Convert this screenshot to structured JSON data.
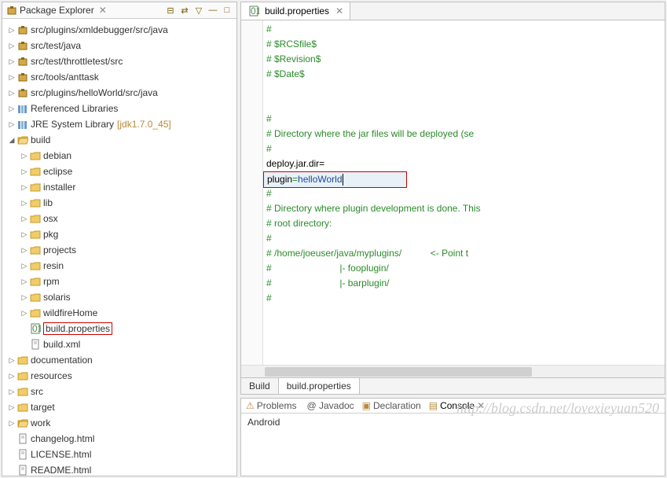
{
  "explorer": {
    "title": "Package Explorer",
    "toolbar": [
      "collapse",
      "link",
      "refresh",
      "menu",
      "min",
      "max"
    ],
    "tree": [
      {
        "ind": 4,
        "arrow": "▷",
        "icon": "pkg",
        "label": "src/plugins/xmldebugger/src/java"
      },
      {
        "ind": 4,
        "arrow": "▷",
        "icon": "pkg",
        "label": "src/test/java"
      },
      {
        "ind": 4,
        "arrow": "▷",
        "icon": "pkg",
        "label": "src/test/throttletest/src"
      },
      {
        "ind": 4,
        "arrow": "▷",
        "icon": "pkg",
        "label": "src/tools/anttask"
      },
      {
        "ind": 4,
        "arrow": "▷",
        "icon": "pkg",
        "label": "src/plugins/helloWorld/src/java"
      },
      {
        "ind": 4,
        "arrow": "▷",
        "icon": "lib",
        "label": "Referenced Libraries"
      },
      {
        "ind": 4,
        "arrow": "▷",
        "icon": "lib",
        "label": "JRE System Library",
        "extra": "[jdk1.7.0_45]"
      },
      {
        "ind": 4,
        "arrow": "◢",
        "icon": "folder-open",
        "label": "build"
      },
      {
        "ind": 20,
        "arrow": "▷",
        "icon": "folder",
        "label": "debian"
      },
      {
        "ind": 20,
        "arrow": "▷",
        "icon": "folder",
        "label": "eclipse"
      },
      {
        "ind": 20,
        "arrow": "▷",
        "icon": "folder",
        "label": "installer"
      },
      {
        "ind": 20,
        "arrow": "▷",
        "icon": "folder",
        "label": "lib"
      },
      {
        "ind": 20,
        "arrow": "▷",
        "icon": "folder",
        "label": "osx"
      },
      {
        "ind": 20,
        "arrow": "▷",
        "icon": "folder",
        "label": "pkg"
      },
      {
        "ind": 20,
        "arrow": "▷",
        "icon": "folder",
        "label": "projects"
      },
      {
        "ind": 20,
        "arrow": "▷",
        "icon": "folder",
        "label": "resin"
      },
      {
        "ind": 20,
        "arrow": "▷",
        "icon": "folder",
        "label": "rpm"
      },
      {
        "ind": 20,
        "arrow": "▷",
        "icon": "folder",
        "label": "solaris"
      },
      {
        "ind": 20,
        "arrow": "▷",
        "icon": "folder",
        "label": "wildfireHome"
      },
      {
        "ind": 20,
        "arrow": "",
        "icon": "props",
        "label": "build.properties",
        "hl": true
      },
      {
        "ind": 20,
        "arrow": "",
        "icon": "file",
        "label": "build.xml"
      },
      {
        "ind": 4,
        "arrow": "▷",
        "icon": "folder",
        "label": "documentation"
      },
      {
        "ind": 4,
        "arrow": "▷",
        "icon": "folder",
        "label": "resources"
      },
      {
        "ind": 4,
        "arrow": "▷",
        "icon": "folder",
        "label": "src"
      },
      {
        "ind": 4,
        "arrow": "▷",
        "icon": "folder",
        "label": "target"
      },
      {
        "ind": 4,
        "arrow": "▷",
        "icon": "folder-open",
        "label": "work"
      },
      {
        "ind": 4,
        "arrow": "",
        "icon": "file",
        "label": "changelog.html"
      },
      {
        "ind": 4,
        "arrow": "",
        "icon": "file",
        "label": "LICENSE.html"
      },
      {
        "ind": 4,
        "arrow": "",
        "icon": "file",
        "label": "README.html"
      }
    ]
  },
  "editor": {
    "tab": {
      "label": "build.properties",
      "icon": "props"
    },
    "lines": [
      {
        "t": "#",
        "c": "c"
      },
      {
        "t": "# $RCSfile$",
        "c": "c"
      },
      {
        "t": "# $Revision$",
        "c": "c"
      },
      {
        "t": "# $Date$",
        "c": "c"
      },
      {
        "t": "",
        "c": "c"
      },
      {
        "t": "",
        "c": "c"
      },
      {
        "t": "#",
        "c": "c"
      },
      {
        "t": "# Directory where the jar files will be deployed (se",
        "c": "c"
      },
      {
        "t": "#",
        "c": "c"
      },
      {
        "t": "deploy.jar.dir=",
        "c": "k"
      },
      {
        "t": "",
        "c": "hl",
        "key": "plugin",
        "val": "helloWorld"
      },
      {
        "t": "#",
        "c": "c"
      },
      {
        "t": "# Directory where plugin development is done. This ",
        "c": "c"
      },
      {
        "t": "# root directory:",
        "c": "c"
      },
      {
        "t": "#",
        "c": "c"
      },
      {
        "t": "# /home/joeuser/java/myplugins/           <- Point t",
        "c": "c"
      },
      {
        "t": "#                          |- fooplugin/",
        "c": "c"
      },
      {
        "t": "#                          |- barplugin/",
        "c": "c"
      },
      {
        "t": "#",
        "c": "c"
      }
    ],
    "bottom_tabs": [
      "Build",
      "build.properties"
    ]
  },
  "bottom_panel": {
    "tabs": [
      {
        "icon": "prob",
        "label": "Problems"
      },
      {
        "icon": "jdoc",
        "label": "@ Javadoc"
      },
      {
        "icon": "decl",
        "label": "Declaration"
      },
      {
        "icon": "cons",
        "label": "Console",
        "active": true
      }
    ],
    "body": "Android"
  },
  "watermark": "http://blog.csdn.net/lovexieyuan520"
}
